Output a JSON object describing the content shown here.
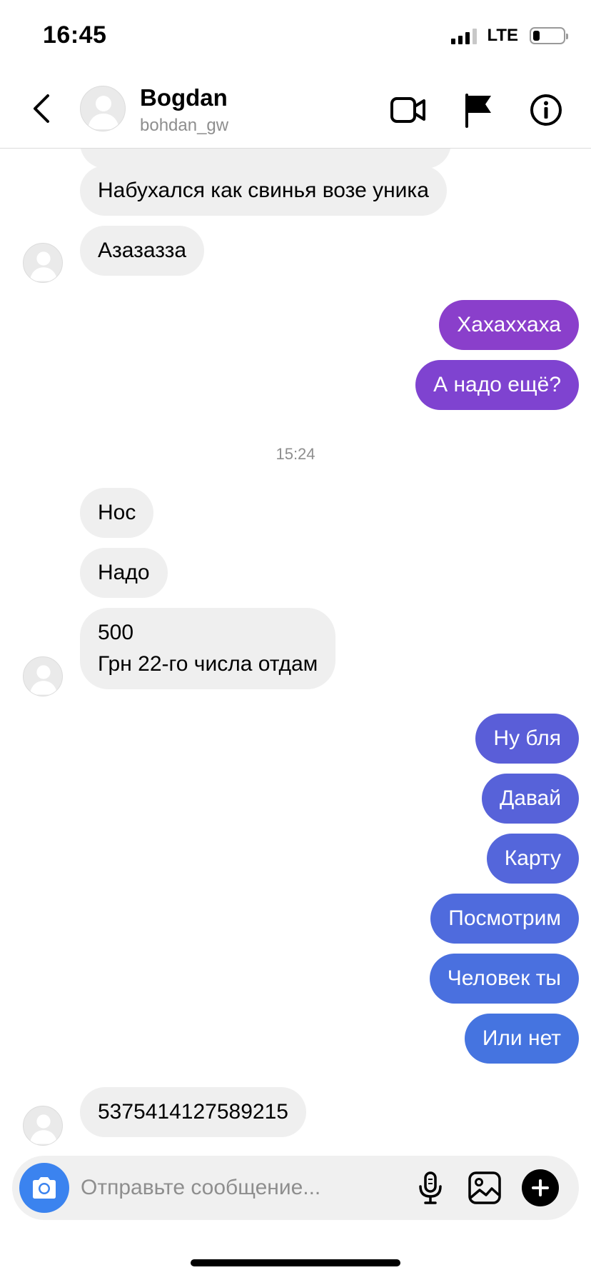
{
  "status_bar": {
    "time": "16:45",
    "network": "LTE"
  },
  "header": {
    "name": "Bogdan",
    "handle": "bohdan_gw",
    "back_icon": "chevron-left-icon",
    "video_icon": "video-camera-icon",
    "flag_icon": "flag-icon",
    "info_icon": "info-icon"
  },
  "messages": [
    {
      "text": "Набухался как свинья возе уника",
      "direction": "incoming"
    },
    {
      "text": "Азазазза",
      "direction": "incoming"
    },
    {
      "text": "Хахаххаха",
      "direction": "outgoing"
    },
    {
      "text": "А надо ещё?",
      "direction": "outgoing"
    },
    {
      "text": "15:24",
      "direction": "timestamp"
    },
    {
      "text": "Нос",
      "direction": "incoming"
    },
    {
      "text": "Надо",
      "direction": "incoming"
    },
    {
      "text": "500\nГрн 22-го числа отдам",
      "direction": "incoming"
    },
    {
      "text": "Ну бля",
      "direction": "outgoing"
    },
    {
      "text": "Давай",
      "direction": "outgoing"
    },
    {
      "text": "Карту",
      "direction": "outgoing"
    },
    {
      "text": "Посмотрим",
      "direction": "outgoing"
    },
    {
      "text": "Человек ты",
      "direction": "outgoing"
    },
    {
      "text": "Или нет",
      "direction": "outgoing"
    },
    {
      "text": "5375414127589215",
      "direction": "incoming"
    }
  ],
  "composer": {
    "placeholder": "Отправьте сообщение...",
    "camera_icon": "camera-icon",
    "mic_icon": "microphone-icon",
    "gallery_icon": "image-icon",
    "plus_icon": "plus-icon"
  },
  "colors": {
    "incoming_bubble": "#efefef",
    "outgoing_top": "#8a3fcb",
    "outgoing_bottom": "#4574e0",
    "camera_button": "#3b83ef",
    "muted_text": "#8e8e8e"
  }
}
